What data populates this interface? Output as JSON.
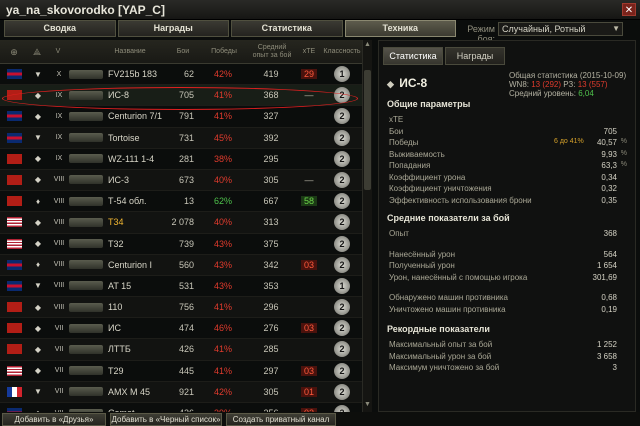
{
  "window": {
    "title": "ya_na_skovorodko [YAP_C]",
    "close_glyph": "✕"
  },
  "tabs": [
    {
      "label": "Сводка",
      "active": false
    },
    {
      "label": "Награды",
      "active": false
    },
    {
      "label": "Статистика",
      "active": false
    },
    {
      "label": "Техника",
      "active": true
    }
  ],
  "battle_mode": {
    "label": "Режим боя:",
    "value": "Случайный, Ротный"
  },
  "table": {
    "headers": {
      "name": "Название",
      "battles": "Бои",
      "wins": "Победы",
      "avg_xp": "Средний опыт за бой",
      "xte": "xTE",
      "mastery": "Классность"
    },
    "rows": [
      {
        "flag": "uk",
        "cls": "▼",
        "tier": "X",
        "name": "FV215b 183",
        "battles": "62",
        "wins": "42%",
        "wins_color": "red",
        "avg_xp": "419",
        "xte": "29",
        "xte_style": "bg-red",
        "mastery": "1",
        "gold": false
      },
      {
        "flag": "ussr",
        "cls": "◆",
        "tier": "IX",
        "name": "ИС-8",
        "battles": "705",
        "wins": "41%",
        "wins_color": "red",
        "avg_xp": "368",
        "xte": "—",
        "xte_style": "",
        "mastery": "2",
        "gold": false
      },
      {
        "flag": "uk",
        "cls": "◆",
        "tier": "IX",
        "name": "Centurion 7/1",
        "battles": "791",
        "wins": "41%",
        "wins_color": "red",
        "avg_xp": "327",
        "xte": "",
        "xte_style": "",
        "mastery": "2",
        "gold": false
      },
      {
        "flag": "uk",
        "cls": "▼",
        "tier": "IX",
        "name": "Tortoise",
        "battles": "731",
        "wins": "45%",
        "wins_color": "red",
        "avg_xp": "392",
        "xte": "",
        "xte_style": "",
        "mastery": "2",
        "gold": false
      },
      {
        "flag": "ussr",
        "cls": "◆",
        "tier": "IX",
        "name": "WZ-111 1-4",
        "battles": "281",
        "wins": "38%",
        "wins_color": "red",
        "avg_xp": "295",
        "xte": "",
        "xte_style": "",
        "mastery": "2",
        "gold": false
      },
      {
        "flag": "ussr",
        "cls": "◆",
        "tier": "VIII",
        "name": "ИС-3",
        "battles": "673",
        "wins": "40%",
        "wins_color": "red",
        "avg_xp": "305",
        "xte": "—",
        "xte_style": "",
        "mastery": "2",
        "gold": false
      },
      {
        "flag": "ussr",
        "cls": "♦",
        "tier": "VIII",
        "name": "Т-54 обл.",
        "battles": "13",
        "wins": "62%",
        "wins_color": "green",
        "avg_xp": "667",
        "xte": "58",
        "xte_style": "bg-green",
        "mastery": "2",
        "gold": false
      },
      {
        "flag": "us",
        "cls": "◆",
        "tier": "VIII",
        "name": "T34",
        "battles": "2 078",
        "wins": "40%",
        "wins_color": "red",
        "avg_xp": "313",
        "xte": "",
        "xte_style": "",
        "mastery": "2",
        "gold": true
      },
      {
        "flag": "us",
        "cls": "◆",
        "tier": "VIII",
        "name": "T32",
        "battles": "739",
        "wins": "43%",
        "wins_color": "red",
        "avg_xp": "375",
        "xte": "",
        "xte_style": "",
        "mastery": "2",
        "gold": false
      },
      {
        "flag": "uk",
        "cls": "♦",
        "tier": "VIII",
        "name": "Centurion I",
        "battles": "560",
        "wins": "43%",
        "wins_color": "red",
        "avg_xp": "342",
        "xte": "03",
        "xte_style": "bg-red",
        "mastery": "2",
        "gold": false
      },
      {
        "flag": "uk",
        "cls": "▼",
        "tier": "VIII",
        "name": "AT 15",
        "battles": "531",
        "wins": "43%",
        "wins_color": "red",
        "avg_xp": "353",
        "xte": "",
        "xte_style": "",
        "mastery": "1",
        "gold": false
      },
      {
        "flag": "ussr",
        "cls": "◆",
        "tier": "VIII",
        "name": "110",
        "battles": "756",
        "wins": "41%",
        "wins_color": "red",
        "avg_xp": "296",
        "xte": "",
        "xte_style": "",
        "mastery": "2",
        "gold": false
      },
      {
        "flag": "ussr",
        "cls": "◆",
        "tier": "VII",
        "name": "ИС",
        "battles": "474",
        "wins": "46%",
        "wins_color": "red",
        "avg_xp": "276",
        "xte": "03",
        "xte_style": "bg-red",
        "mastery": "2",
        "gold": false
      },
      {
        "flag": "ussr",
        "cls": "◆",
        "tier": "VII",
        "name": "ЛТТБ",
        "battles": "426",
        "wins": "41%",
        "wins_color": "red",
        "avg_xp": "285",
        "xte": "",
        "xte_style": "",
        "mastery": "2",
        "gold": false
      },
      {
        "flag": "us",
        "cls": "◆",
        "tier": "VII",
        "name": "T29",
        "battles": "445",
        "wins": "41%",
        "wins_color": "red",
        "avg_xp": "297",
        "xte": "03",
        "xte_style": "bg-red",
        "mastery": "2",
        "gold": false
      },
      {
        "flag": "fr",
        "cls": "▼",
        "tier": "VII",
        "name": "AMX M 45",
        "battles": "921",
        "wins": "42%",
        "wins_color": "red",
        "avg_xp": "305",
        "xte": "01",
        "xte_style": "bg-red",
        "mastery": "2",
        "gold": false
      },
      {
        "flag": "uk",
        "cls": "◆",
        "tier": "VII",
        "name": "Comet",
        "battles": "426",
        "wins": "39%",
        "wins_color": "red",
        "avg_xp": "256",
        "xte": "02",
        "xte_style": "bg-red",
        "mastery": "2",
        "gold": false
      }
    ]
  },
  "right_panel": {
    "tabs": [
      {
        "label": "Статистика",
        "active": true
      },
      {
        "label": "Награды",
        "active": false
      }
    ],
    "vehicle": {
      "diamond": "◆",
      "name": "ИС-8"
    },
    "summary": {
      "line1": "Общая статистика (2015-10-09)",
      "line2_prefix": "WN8:",
      "line2_a": "13 (292)",
      "line2_mid": "РЗ:",
      "line2_b": "13 (557)",
      "line3_prefix": "Средний уровень:",
      "line3_val": "6,04"
    },
    "sections": {
      "general": "Общие параметры",
      "avg": "Средние показатели за бой",
      "records": "Рекордные показатели"
    },
    "general": [
      {
        "label": "xTE",
        "value": "",
        "pct": ""
      },
      {
        "label": "Бои",
        "value": "705",
        "pct": ""
      },
      {
        "label": "Победы",
        "value": "40,57",
        "pct": "%",
        "mid": "6 до 41%"
      },
      {
        "label": "Выживаемость",
        "value": "9,93",
        "pct": "%"
      },
      {
        "label": "Попадания",
        "value": "63,3",
        "pct": "%"
      },
      {
        "label": "Коэффициент урона",
        "value": "0,34",
        "pct": ""
      },
      {
        "label": "Коэффициент уничтожения",
        "value": "0,32",
        "pct": ""
      },
      {
        "label": "Эффективность использования брони",
        "value": "0,35",
        "pct": ""
      }
    ],
    "avg": [
      {
        "label": "Опыт",
        "value": "368"
      },
      {
        "label": "Нанесённый урон",
        "value": "564"
      },
      {
        "label": "Полученный урон",
        "value": "1 654"
      },
      {
        "label": "Урон, нанесённый с помощью игрока",
        "value": "301,69"
      },
      {
        "label": "Обнаружено машин противника",
        "value": "0,68"
      },
      {
        "label": "Уничтожено машин противника",
        "value": "0,19"
      }
    ],
    "records": [
      {
        "label": "Максимальный опыт за бой",
        "value": "1 252"
      },
      {
        "label": "Максимальный урон за бой",
        "value": "3 658"
      },
      {
        "label": "Максимум уничтожено за бой",
        "value": "3"
      }
    ]
  },
  "bottom_buttons": [
    {
      "label": "Добавить в «Друзья»"
    },
    {
      "label": "Добавить в «Черный список»"
    },
    {
      "label": "Создать приватный канал"
    }
  ]
}
